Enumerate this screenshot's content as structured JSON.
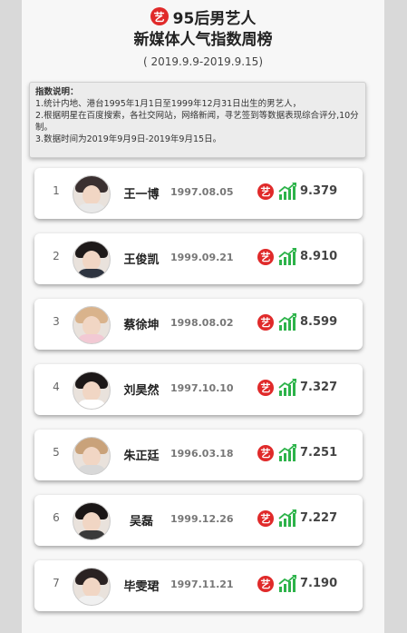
{
  "header": {
    "logo_char": "艺",
    "title_line1": "95后男艺人",
    "title_line2": "新媒体人气指数周榜",
    "date_range": "( 2019.9.9-2019.9.15)"
  },
  "description": {
    "title": "指数说明：",
    "lines": [
      "1.统计内地、港台1995年1月1日至1999年12月31日出生的男艺人，",
      "2.根据明星在百度搜索，各社交网站，网络新闻，寻艺签到等数据表现综合评分,10分制。",
      "3.数据时间为2019年9月9日-2019年9月15日。"
    ]
  },
  "colors": {
    "brand_red": "#e02a2a",
    "trend_green": "#2db34a"
  },
  "rankings": [
    {
      "rank": "1",
      "name": "王一博",
      "birth": "1997.08.05",
      "score": "9.379",
      "badge_char": "艺",
      "trend_icon": "trend-up-icon",
      "hair": "#3a3030",
      "shirt": "#e8e8e8"
    },
    {
      "rank": "2",
      "name": "王俊凯",
      "birth": "1999.09.21",
      "score": "8.910",
      "badge_char": "艺",
      "trend_icon": "trend-up-icon",
      "hair": "#1e1a1a",
      "shirt": "#2e3440"
    },
    {
      "rank": "3",
      "name": "蔡徐坤",
      "birth": "1998.08.02",
      "score": "8.599",
      "badge_char": "艺",
      "trend_icon": "trend-up-icon",
      "hair": "#d9b38c",
      "shirt": "#f2c9d4"
    },
    {
      "rank": "4",
      "name": "刘昊然",
      "birth": "1997.10.10",
      "score": "7.327",
      "badge_char": "艺",
      "trend_icon": "trend-up-icon",
      "hair": "#1c1818",
      "shirt": "#ffffff"
    },
    {
      "rank": "5",
      "name": "朱正廷",
      "birth": "1996.03.18",
      "score": "7.251",
      "badge_char": "艺",
      "trend_icon": "trend-up-icon",
      "hair": "#c9a27a",
      "shirt": "#d8d8d8"
    },
    {
      "rank": "6",
      "name": "吴磊",
      "birth": "1999.12.26",
      "score": "7.227",
      "badge_char": "艺",
      "trend_icon": "trend-up-icon",
      "hair": "#1a1616",
      "shirt": "#3a3a3a"
    },
    {
      "rank": "7",
      "name": "毕雯珺",
      "birth": "1997.11.21",
      "score": "7.190",
      "badge_char": "艺",
      "trend_icon": "trend-up-icon",
      "hair": "#2a2222",
      "shirt": "#f0f0f0"
    }
  ]
}
